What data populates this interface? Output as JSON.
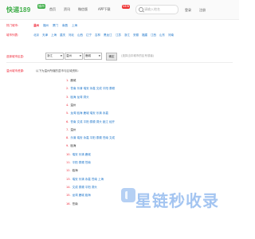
{
  "header": {
    "logo_text": "快递189",
    "logo_badge": "城市",
    "nav": [
      "首页",
      "资讯",
      "微信版",
      "APP下载"
    ],
    "nav_badge": "NEW",
    "search_placeholder": "请输入地名",
    "auth": [
      "登录",
      "注册"
    ]
  },
  "categories": {
    "hot_label": "热门城市:",
    "hot": [
      "温州",
      "福州",
      "厦门",
      "南昌",
      "上海"
    ],
    "all_label": "城市列表:",
    "all": [
      "北京",
      "天津",
      "上海",
      "重庆",
      "河北",
      "山西",
      "辽宁",
      "吉林",
      "黑龙江",
      "江苏",
      "浙江",
      "安徽",
      "福建",
      "江西",
      "山东",
      "河南"
    ]
  },
  "area_query": {
    "label": "选择城市区县:",
    "province": "浙江",
    "city": "温州",
    "district": "鹿城",
    "button": "确定",
    "hint": "(选择当中城市的区号或者)"
  },
  "intro": {
    "label": "温州城市资源:",
    "text": "以下为温州所辖的县市与区域资料:"
  },
  "regions": [
    {
      "num": "1.",
      "name": "鹿城",
      "tags": ""
    },
    {
      "num": "2.",
      "name": "",
      "tags": "苍南 乐清 瑞安 永嘉 文成 平阳 泰顺"
    },
    {
      "num": "3.",
      "name": "",
      "tags": "瓯海 龙湾 洞头"
    },
    {
      "num": "4.",
      "name": "温州",
      "tags": ""
    },
    {
      "num": "5.",
      "name": "",
      "tags": "龙湾 瓯海 鹿城 瑞安 乐清 永嘉"
    },
    {
      "num": "6.",
      "name": "",
      "tags": "苍南 文成 平阳 泰顺 洞头 瓯江 经开"
    },
    {
      "num": "7.",
      "name": "温州",
      "tags": ""
    },
    {
      "num": "8.",
      "name": "",
      "tags": "乐清 瑞安 永嘉 平阳 泰顺 苍南 文成"
    },
    {
      "num": "9.",
      "name": "瓯海",
      "tags": ""
    },
    {
      "num": "10.",
      "name": "",
      "tags": "瑞安 乐清 鹿城"
    },
    {
      "num": "11.",
      "name": "",
      "tags": "平阳 泰顺 苍南"
    },
    {
      "num": "12.",
      "name": "瓯海",
      "tags": ""
    },
    {
      "num": "13.",
      "name": "",
      "tags": "瑞安 乐清 永嘉 苍南 上海"
    },
    {
      "num": "14.",
      "name": "",
      "tags": "文成 泰顺 平阳 洞头"
    },
    {
      "num": "15.",
      "name": "",
      "tags": "龙湾 鹿城 瓯海"
    },
    {
      "num": "16.",
      "name": "苍南",
      "tags": ""
    }
  ],
  "watermark": "星链秒收录",
  "colors": {
    "brand": "#3fae49",
    "accent": "#e23",
    "link": "#1a73c9"
  }
}
